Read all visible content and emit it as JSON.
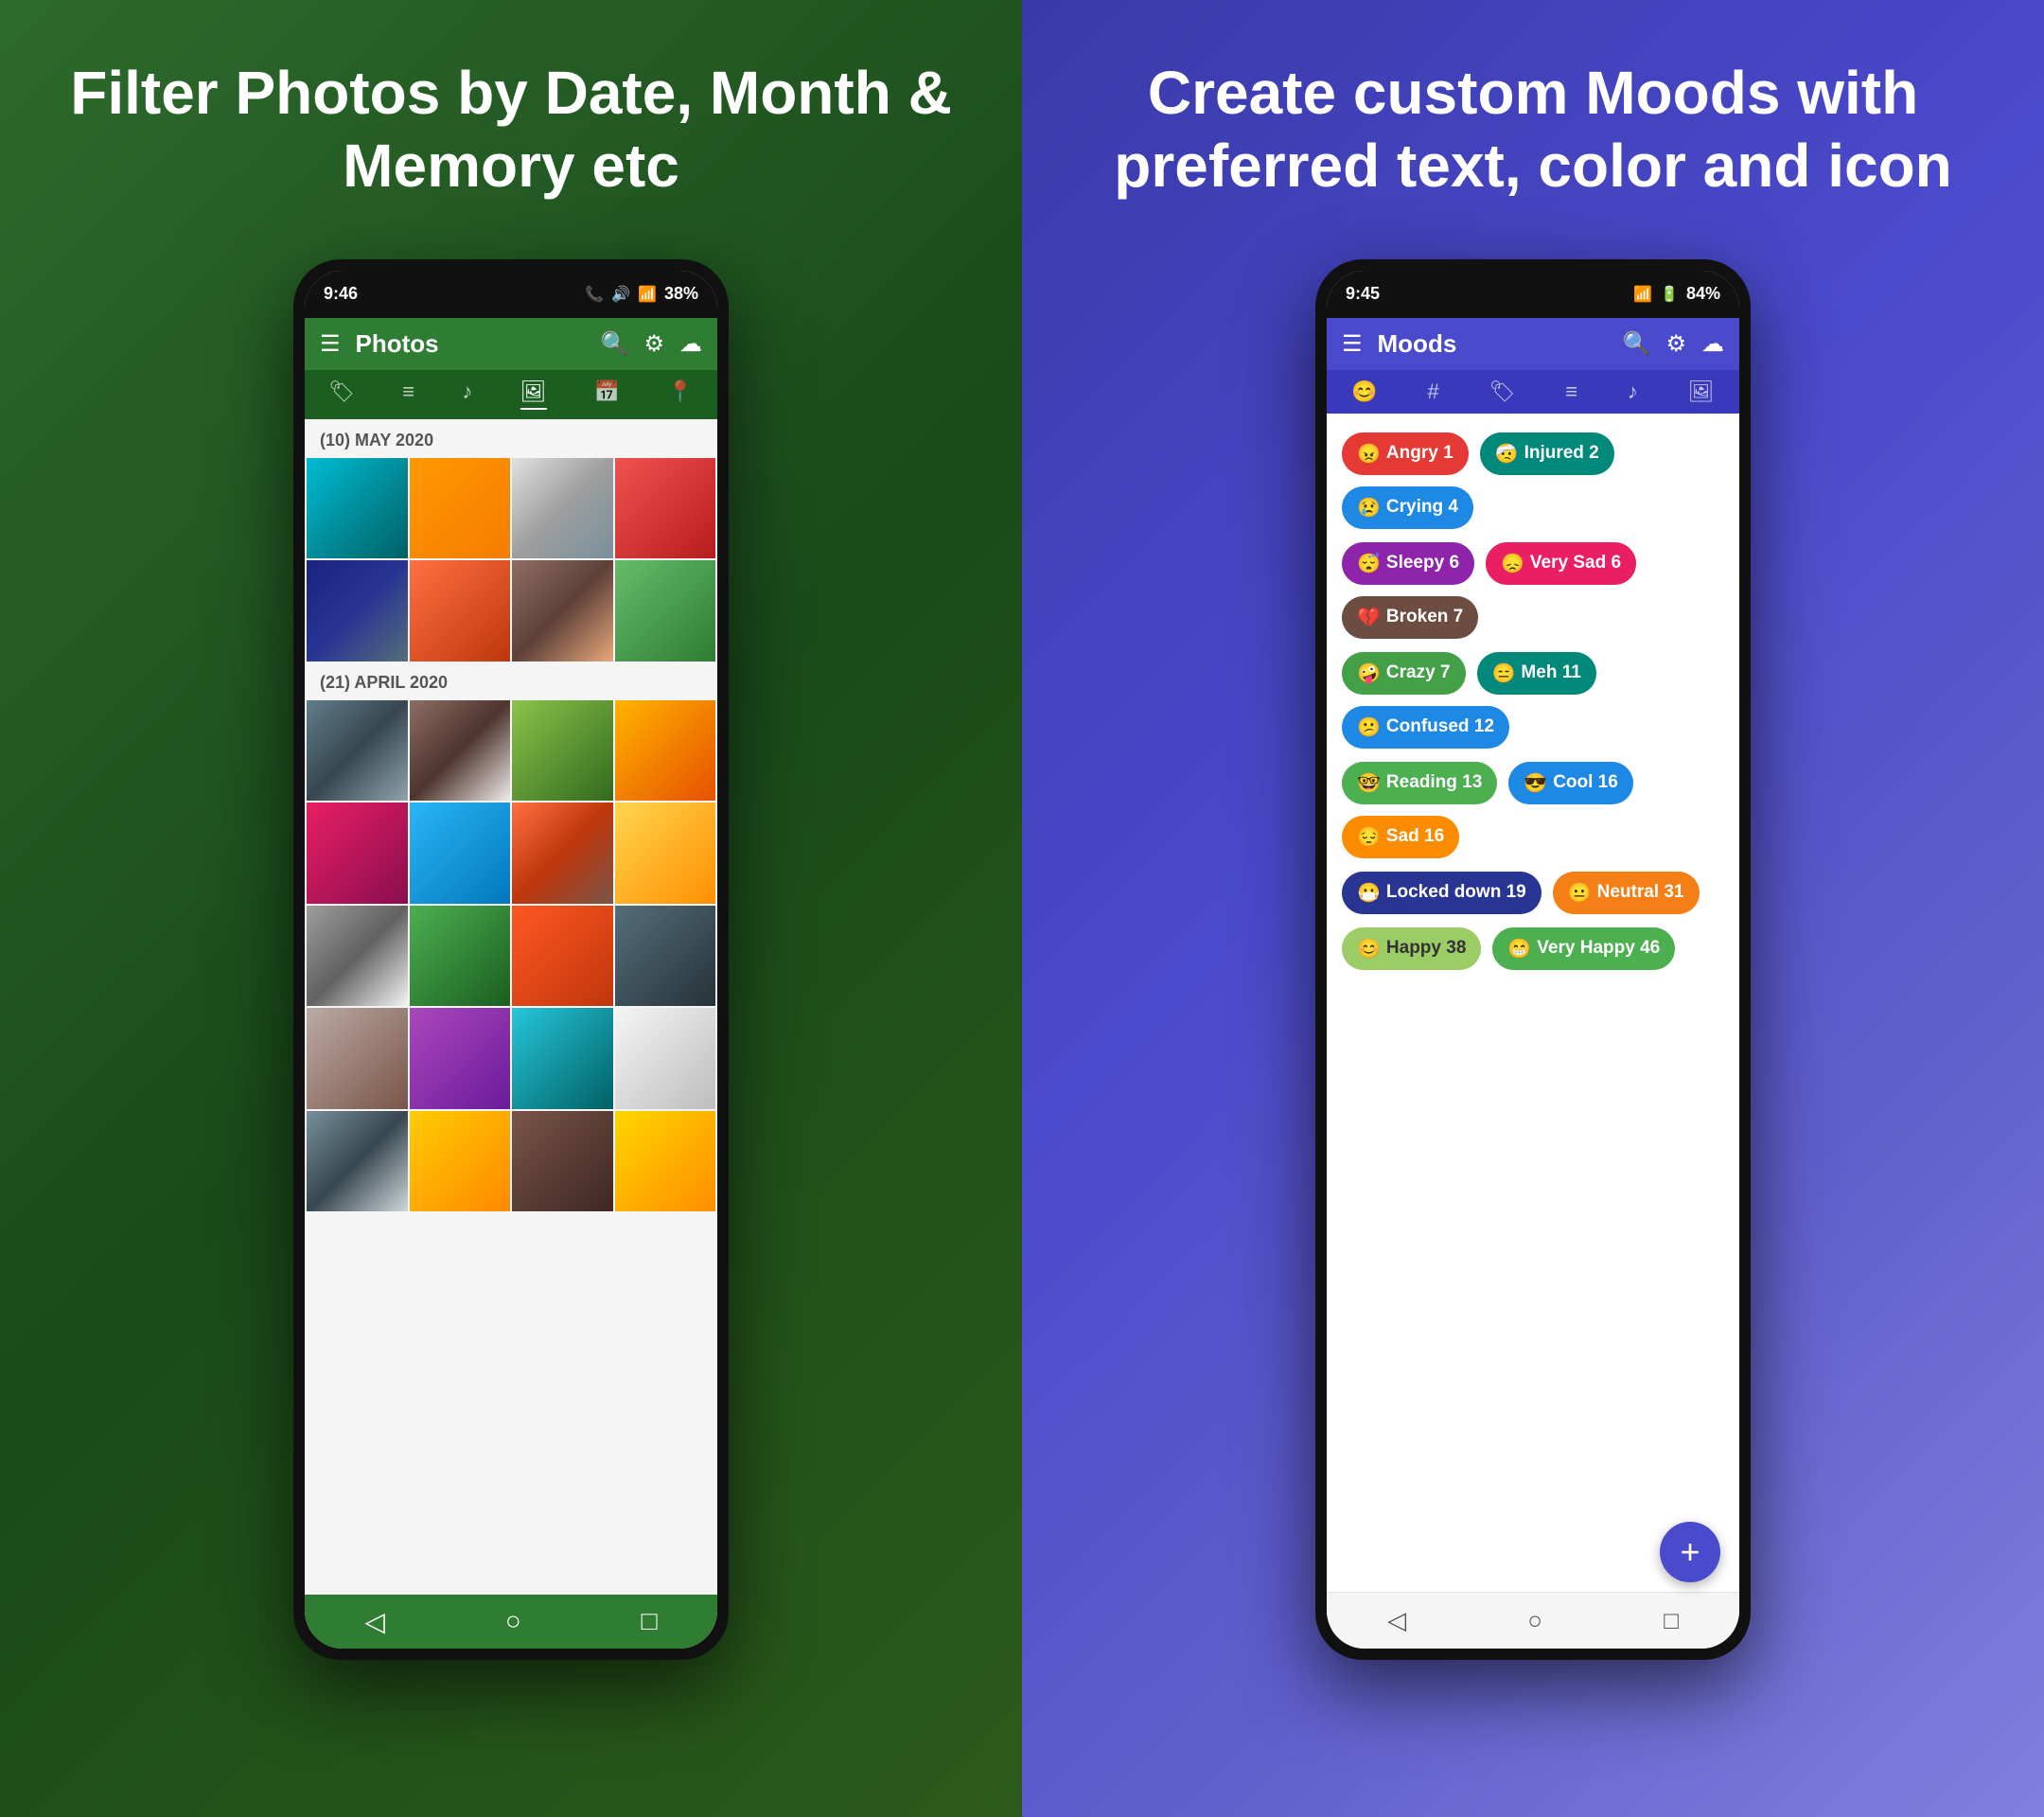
{
  "left": {
    "headline": "Filter Photos by Date, Month & Memory etc",
    "phone": {
      "status_time": "9:46",
      "status_battery": "38%",
      "toolbar_title": "Photos",
      "sections": [
        {
          "label": "(10)  MAY 2020",
          "photos": [
            "p1",
            "p2",
            "p3",
            "p4",
            "p5",
            "p6",
            "p7",
            "p8"
          ]
        },
        {
          "label": "(21)  APRIL 2020",
          "photos": [
            "p9",
            "p10",
            "p11",
            "p12",
            "p13",
            "p14",
            "p15",
            "p16",
            "p17",
            "p18",
            "p19",
            "p20",
            "p21",
            "p22",
            "p23",
            "p24"
          ]
        }
      ]
    }
  },
  "right": {
    "headline": "Create custom Moods with preferred text, color and icon",
    "phone": {
      "status_time": "9:45",
      "status_battery": "84%",
      "toolbar_title": "Moods",
      "moods": [
        {
          "label": "Angry",
          "count": 1,
          "emoji": "😠",
          "color": "chip-red"
        },
        {
          "label": "Injured",
          "count": 2,
          "emoji": "🤕",
          "color": "chip-teal"
        },
        {
          "label": "Crying",
          "count": 4,
          "emoji": "😢",
          "color": "chip-blue"
        },
        {
          "label": "Sleepy",
          "count": 6,
          "emoji": "😴",
          "color": "chip-purple"
        },
        {
          "label": "Very Sad",
          "count": 6,
          "emoji": "😞",
          "color": "chip-pink"
        },
        {
          "label": "Broken",
          "count": 7,
          "emoji": "💔",
          "color": "chip-brown"
        },
        {
          "label": "Crazy",
          "count": 7,
          "emoji": "🤪",
          "color": "chip-green"
        },
        {
          "label": "Meh",
          "count": 11,
          "emoji": "😑",
          "color": "chip-teal"
        },
        {
          "label": "Confused",
          "count": 12,
          "emoji": "😕",
          "color": "chip-blue"
        },
        {
          "label": "Reading",
          "count": 13,
          "emoji": "🤓",
          "color": "chip-bright-green"
        },
        {
          "label": "Cool",
          "count": 16,
          "emoji": "😎",
          "color": "chip-blue"
        },
        {
          "label": "Sad",
          "count": 16,
          "emoji": "😔",
          "color": "chip-orange"
        },
        {
          "label": "Locked down",
          "count": 19,
          "emoji": "😷",
          "color": "chip-dark-blue"
        },
        {
          "label": "Neutral",
          "count": 31,
          "emoji": "😐",
          "color": "chip-yellow-dark"
        },
        {
          "label": "Happy",
          "count": 38,
          "emoji": "😊",
          "color": "chip-yellow-green"
        },
        {
          "label": "Very Happy",
          "count": 46,
          "emoji": "😁",
          "color": "chip-bright-green"
        }
      ],
      "fab_label": "+"
    }
  }
}
